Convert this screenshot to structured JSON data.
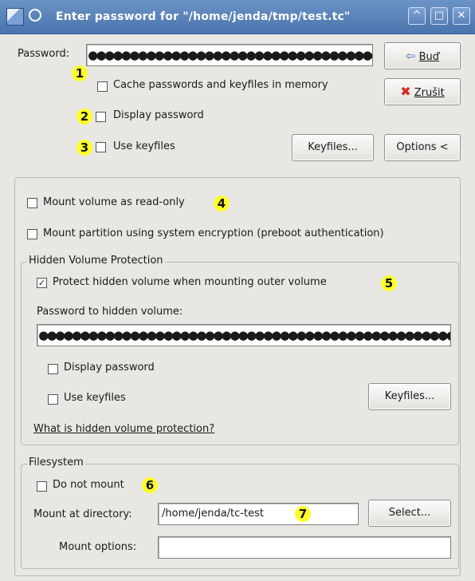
{
  "window": {
    "title": "Enter password for \"/home/jenda/tmp/test.tc\"",
    "controls": {
      "minimize": "^",
      "maximize": "□",
      "close": "✕"
    }
  },
  "password": {
    "label": "Password:",
    "value": "●●●●●●●●●●●●●●●●●●●●●●●●●●●●●●●●●●●",
    "cache_label": "Cache passwords and keyfiles in memory",
    "display_label": "Display password",
    "use_keyfiles_label": "Use keyfiles"
  },
  "buttons": {
    "ok": "Buď",
    "cancel": "Zrušit",
    "keyfiles": "Keyfiles...",
    "options": "Options <"
  },
  "options": {
    "readonly_label": "Mount volume as read-only",
    "system_enc_label": "Mount partition using system encryption (preboot authentication)"
  },
  "hidden": {
    "group_title": "Hidden Volume Protection",
    "protect_label": "Protect hidden volume when mounting outer volume",
    "protect_checked": true,
    "password_label": "Password to hidden volume:",
    "password_value": "●●●●●●●●●●●●●●●●●●●●●●●●●●●●●●●●●●●●●●●●●●●●●●●●●●",
    "display_label": "Display password",
    "use_keyfiles_label": "Use keyfiles",
    "keyfiles_button": "Keyfiles...",
    "help_link": "What is hidden volume protection?"
  },
  "filesystem": {
    "group_title": "Filesystem",
    "do_not_mount_label": "Do not mount",
    "mount_dir_label": "Mount at directory:",
    "mount_dir_value": "/home/jenda/tc-test",
    "select_button": "Select...",
    "mount_options_label": "Mount options:",
    "mount_options_value": ""
  },
  "annotations": [
    "1",
    "2",
    "3",
    "4",
    "5",
    "6",
    "7"
  ],
  "icons": {
    "app": "app-icon",
    "menu": "menu-circle-icon",
    "ok": "arrow-left-icon",
    "cancel": "red-x-icon"
  },
  "colors": {
    "title_bar": "#4f79b4",
    "badge": "#ffff2a",
    "window_bg": "#e8e7e3"
  }
}
